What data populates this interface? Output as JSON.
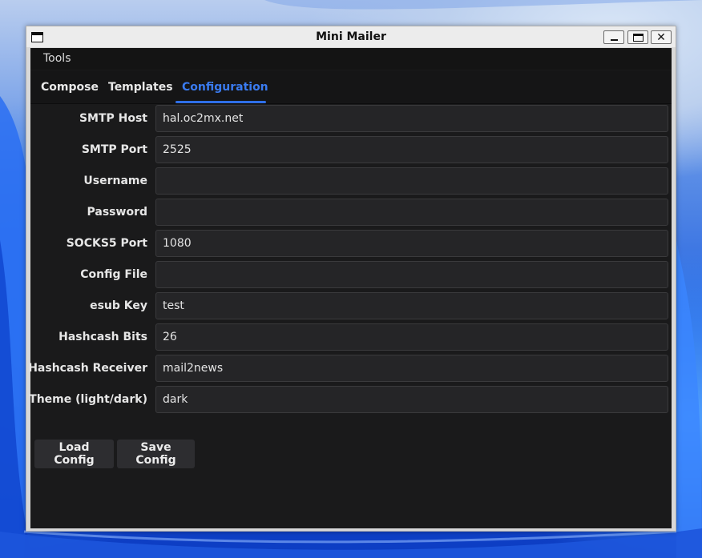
{
  "window": {
    "title": "Mini Mailer"
  },
  "menu": {
    "items": [
      "Tools"
    ]
  },
  "tabs": [
    {
      "label": "Compose",
      "active": false
    },
    {
      "label": "Templates",
      "active": false
    },
    {
      "label": "Configuration",
      "active": true
    }
  ],
  "config": {
    "fields": [
      {
        "label": "SMTP Host",
        "value": "hal.oc2mx.net"
      },
      {
        "label": "SMTP Port",
        "value": "2525"
      },
      {
        "label": "Username",
        "value": ""
      },
      {
        "label": "Password",
        "value": ""
      },
      {
        "label": "SOCKS5 Port",
        "value": "1080"
      },
      {
        "label": "Config File",
        "value": ""
      },
      {
        "label": "esub Key",
        "value": "test"
      },
      {
        "label": "Hashcash Bits",
        "value": "26"
      },
      {
        "label": "Hashcash Receiver",
        "value": "mail2news"
      },
      {
        "label": "Theme (light/dark)",
        "value": "dark"
      }
    ],
    "load_button": "Load Config",
    "save_button": "Save Config"
  },
  "colors": {
    "accent": "#2f6fe8",
    "window_bg": "#1a1a1b",
    "field_bg": "#252527",
    "button_bg": "#2d2d30"
  },
  "icons": {
    "window": "window-icon",
    "minimize": "minimize-icon",
    "maximize": "maximize-icon",
    "close": "close-icon"
  }
}
